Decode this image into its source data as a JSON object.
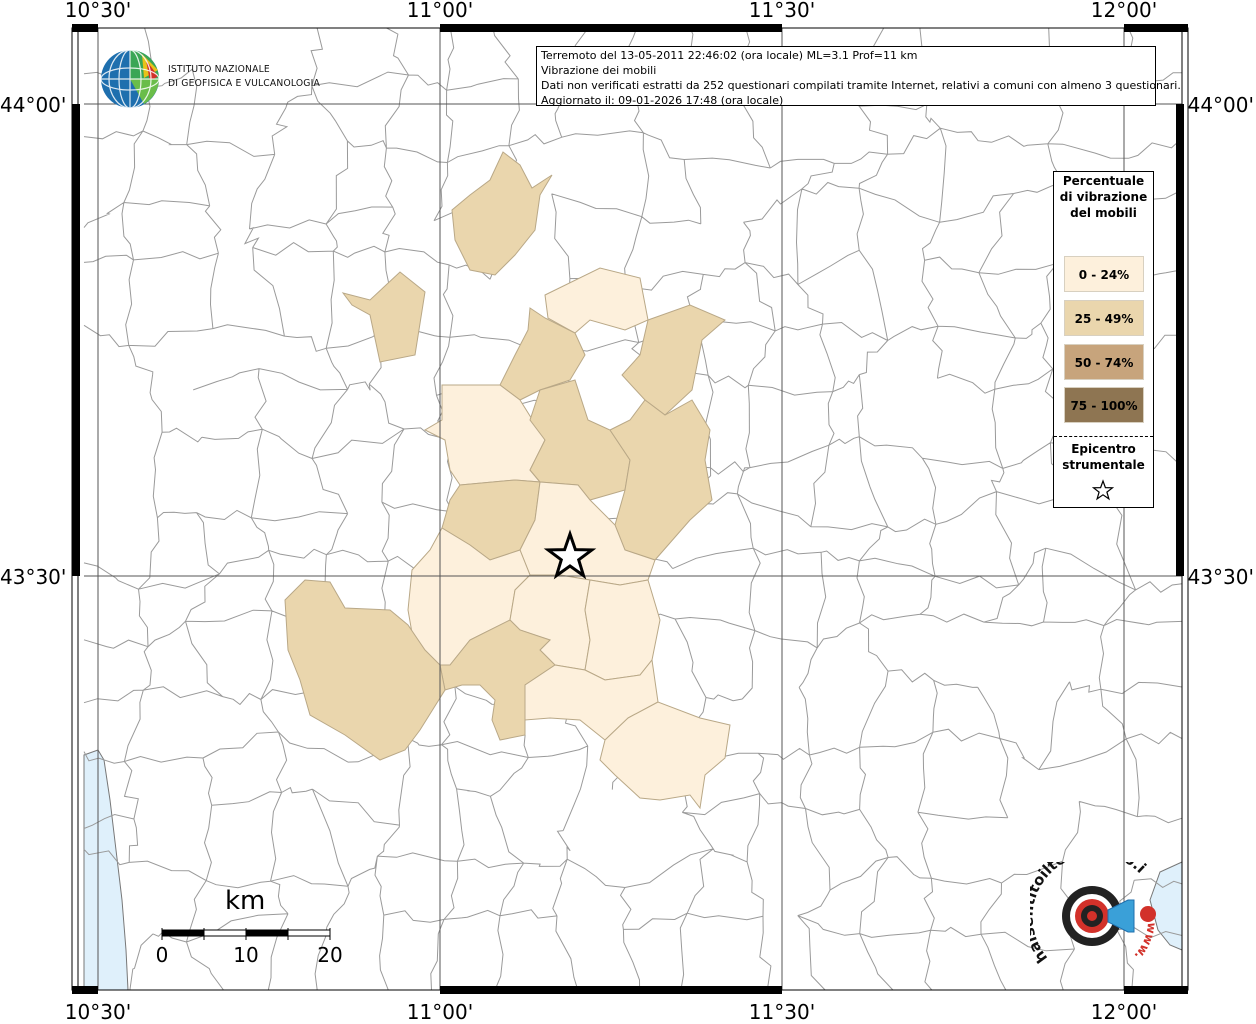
{
  "info": {
    "line1": "Terremoto del 13-05-2011 22:46:02 (ora locale) ML=3.1 Prof=11 km",
    "line2": "Vibrazione dei mobili",
    "line3": "Dati non verificati estratti da 252 questionari compilati tramite Internet, relativi a comuni con almeno 3 questionari.",
    "line4": "Aggiornato il: 09-01-2026 17:48 (ora locale)"
  },
  "ingv": {
    "line1": "ISTITUTO NAZIONALE",
    "line2": "DI GEOFISICA E VULCANOLOGIA"
  },
  "coords": {
    "lon": [
      "10°30'",
      "11°00'",
      "11°30'",
      "12°00'"
    ],
    "lat": [
      "44°00'",
      "43°30'"
    ]
  },
  "legend": {
    "title": "Percentuale di vibrazione del mobili",
    "classes": [
      {
        "label": "0 - 24%",
        "color": "#fdf0dc"
      },
      {
        "label": "25 - 49%",
        "color": "#ead6ad"
      },
      {
        "label": "50 - 74%",
        "color": "#c7a47c"
      },
      {
        "label": "75 - 100%",
        "color": "#8e7552"
      }
    ],
    "epicenter": "Epicentro strumentale"
  },
  "scale": {
    "unit": "km",
    "ticks": [
      "0",
      "10",
      "20"
    ]
  },
  "colors": {
    "sea": "#dff0fb",
    "border": "#9a9a9a",
    "grid": "#555555"
  },
  "hst_logo": {
    "text": "haisentitoilterremoto.it",
    "prefix": "www."
  }
}
